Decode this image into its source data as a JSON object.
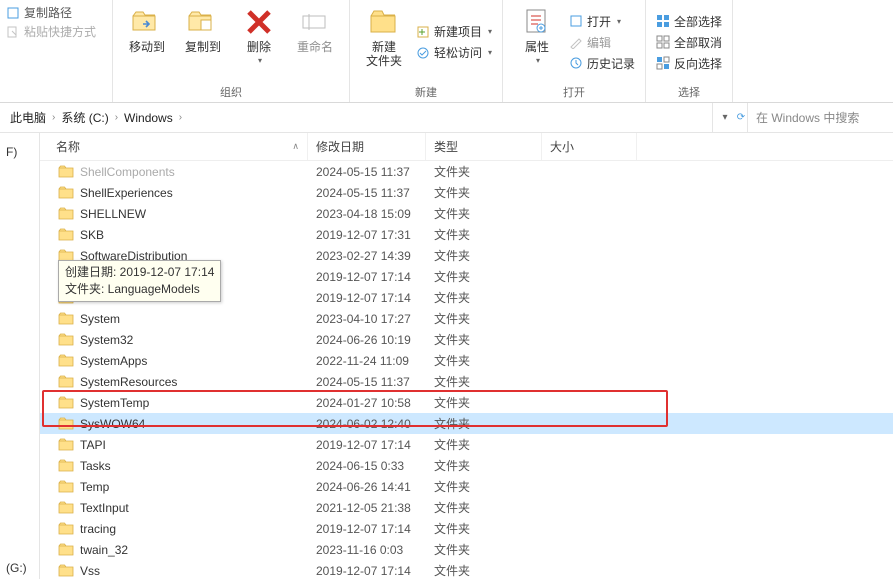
{
  "ribbon": {
    "copy_path": "复制路径",
    "paste_shortcut": "粘贴快捷方式",
    "groups": {
      "organize": "组织",
      "new": "新建",
      "open": "打开",
      "select": "选择"
    },
    "btns": {
      "move_to": "移动到",
      "copy_to": "复制到",
      "delete": "删除",
      "rename": "重命名",
      "new_folder": "新建\n文件夹",
      "new_item": "新建项目",
      "easy_access": "轻松访问",
      "properties": "属性",
      "open": "打开",
      "edit": "编辑",
      "history": "历史记录",
      "select_all": "全部选择",
      "select_none": "全部取消",
      "invert": "反向选择"
    }
  },
  "breadcrumb": {
    "items": [
      "此电脑",
      "系统 (C:)",
      "Windows"
    ],
    "nav_drop": "▾",
    "refresh": "⟳"
  },
  "search": {
    "placeholder": "在 Windows 中搜索"
  },
  "sidebar": {
    "drive_f": "F)",
    "drive_g": "(G:)"
  },
  "columns": {
    "name": "名称",
    "date": "修改日期",
    "type": "类型",
    "size": "大小",
    "sort": "∧"
  },
  "tooltip": {
    "line1": "创建日期: 2019-12-07 17:14",
    "line2": "文件夹: LanguageModels"
  },
  "rows": [
    {
      "name": "ShellComponents",
      "date": "2024-05-15 11:37",
      "type": "文件夹",
      "dim": true
    },
    {
      "name": "ShellExperiences",
      "date": "2024-05-15 11:37",
      "type": "文件夹"
    },
    {
      "name": "SHELLNEW",
      "date": "2023-04-18 15:09",
      "type": "文件夹"
    },
    {
      "name": "SKB",
      "date": "2019-12-07 17:31",
      "type": "文件夹"
    },
    {
      "name": "SoftwareDistribution",
      "date": "2023-02-27 14:39",
      "type": "文件夹"
    },
    {
      "name": "",
      "date": "2019-12-07 17:14",
      "type": "文件夹",
      "covered": true
    },
    {
      "name": "",
      "date": "2019-12-07 17:14",
      "type": "文件夹",
      "covered": true
    },
    {
      "name": "System",
      "date": "2023-04-10 17:27",
      "type": "文件夹"
    },
    {
      "name": "System32",
      "date": "2024-06-26 10:19",
      "type": "文件夹"
    },
    {
      "name": "SystemApps",
      "date": "2022-11-24 11:09",
      "type": "文件夹"
    },
    {
      "name": "SystemResources",
      "date": "2024-05-15 11:37",
      "type": "文件夹"
    },
    {
      "name": "SystemTemp",
      "date": "2024-01-27 10:58",
      "type": "文件夹"
    },
    {
      "name": "SysWOW64",
      "date": "2024-06-02 12:40",
      "type": "文件夹",
      "selected": true
    },
    {
      "name": "TAPI",
      "date": "2019-12-07 17:14",
      "type": "文件夹"
    },
    {
      "name": "Tasks",
      "date": "2024-06-15 0:33",
      "type": "文件夹"
    },
    {
      "name": "Temp",
      "date": "2024-06-26 14:41",
      "type": "文件夹"
    },
    {
      "name": "TextInput",
      "date": "2021-12-05 21:38",
      "type": "文件夹"
    },
    {
      "name": "tracing",
      "date": "2019-12-07 17:14",
      "type": "文件夹"
    },
    {
      "name": "twain_32",
      "date": "2023-11-16 0:03",
      "type": "文件夹"
    },
    {
      "name": "Vss",
      "date": "2019-12-07 17:14",
      "type": "文件夹"
    }
  ]
}
